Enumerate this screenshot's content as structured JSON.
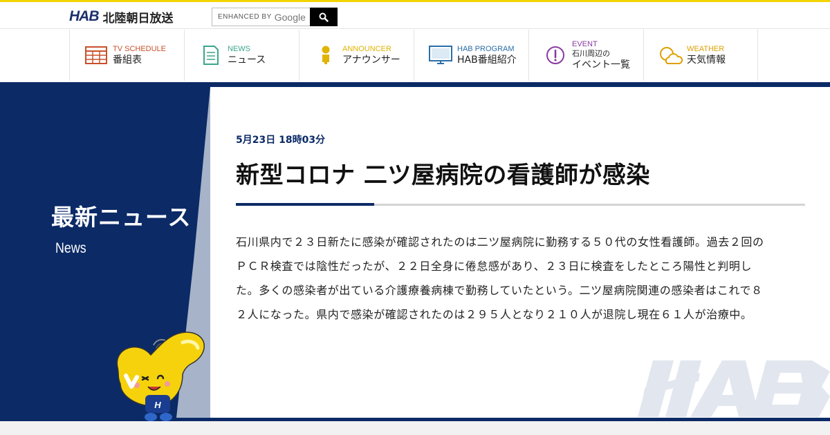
{
  "header": {
    "logo_mark": "HAB",
    "logo_text": "北陸朝日放送",
    "search": {
      "enhanced_label": "ENHANCED BY",
      "google_label": "Google"
    }
  },
  "nav": {
    "items": [
      {
        "en": "TV SCHEDULE",
        "jp": "番組表",
        "color": "#c9502a",
        "icon": "tv-schedule-icon"
      },
      {
        "en": "NEWS",
        "jp": "ニュース",
        "color": "#3aa58a",
        "icon": "news-icon"
      },
      {
        "en": "ANNOUNCER",
        "jp": "アナウンサー",
        "color": "#e0b400",
        "icon": "announcer-icon"
      },
      {
        "en": "HAB PROGRAM",
        "jp": "HAB番組紹介",
        "color": "#2a6ea8",
        "icon": "monitor-icon"
      },
      {
        "en": "EVENT",
        "jp_line1": "石川周辺の",
        "jp_line2": "イベント一覧",
        "color": "#8a3aa0",
        "icon": "exclamation-icon"
      },
      {
        "en": "WEATHER",
        "jp": "天気情報",
        "color": "#e0a000",
        "icon": "weather-icon"
      }
    ]
  },
  "section": {
    "title": "最新ニュース",
    "subtitle": "News"
  },
  "article": {
    "date": "5月23日 18時03分",
    "headline": "新型コロナ 二ツ屋病院の看護師が感染",
    "body": "石川県内で２３日新たに感染が確認されたのは二ツ屋病院に勤務する５０代の女性看護師。過去２回のＰＣＲ検査では陰性だったが、２２日全身に倦怠感があり、２３日に検査をしたところ陽性と判明した。多くの感染者が出ている介護療養病棟で勤務していたという。二ツ屋病院関連の感染者はこれで８２人になった。県内で感染が確認されたのは２９５人となり２１０人が退院し現在６１人が治療中。"
  },
  "watermark_text": "HAB",
  "colors": {
    "navy": "#0b2a66",
    "yellow": "#f2d500"
  }
}
